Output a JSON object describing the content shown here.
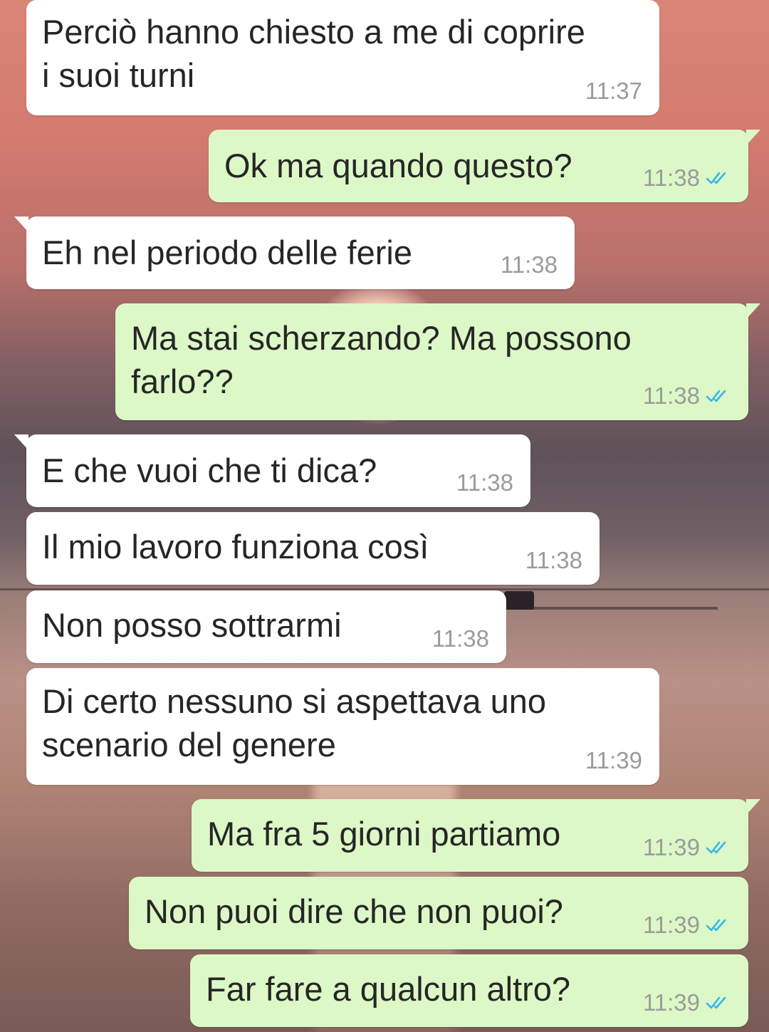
{
  "chat": {
    "messages": [
      {
        "direction": "incoming",
        "text": "Perciò hanno chiesto a me di coprire\ni suoi turni",
        "time": "11:37"
      },
      {
        "direction": "outgoing",
        "text": "Ok ma quando questo?",
        "time": "11:38",
        "status": "read"
      },
      {
        "direction": "incoming",
        "text": "Eh nel periodo delle ferie",
        "time": "11:38"
      },
      {
        "direction": "outgoing",
        "text": "Ma stai scherzando? Ma possono\nfarlo??",
        "time": "11:38",
        "status": "read"
      },
      {
        "direction": "incoming",
        "text": "E che vuoi che ti dica?",
        "time": "11:38"
      },
      {
        "direction": "incoming",
        "text": "Il mio lavoro funziona così",
        "time": "11:38"
      },
      {
        "direction": "incoming",
        "text": "Non posso sottrarmi",
        "time": "11:38"
      },
      {
        "direction": "incoming",
        "text": "Di certo nessuno si aspettava uno\nscenario del genere",
        "time": "11:39"
      },
      {
        "direction": "outgoing",
        "text": "Ma fra 5 giorni partiamo",
        "time": "11:39",
        "status": "read"
      },
      {
        "direction": "outgoing",
        "text": "Non puoi dire che non puoi?",
        "time": "11:39",
        "status": "read"
      },
      {
        "direction": "outgoing",
        "text": "Far fare a qualcun altro?",
        "time": "11:39",
        "status": "read"
      }
    ]
  },
  "colors": {
    "incoming_bubble": "#ffffff",
    "outgoing_bubble": "#dcf8c6",
    "read_check": "#34b7f1",
    "timestamp": "#9b9b9b",
    "text": "#262626"
  },
  "icons": {
    "read_receipt": "double-check-icon"
  }
}
